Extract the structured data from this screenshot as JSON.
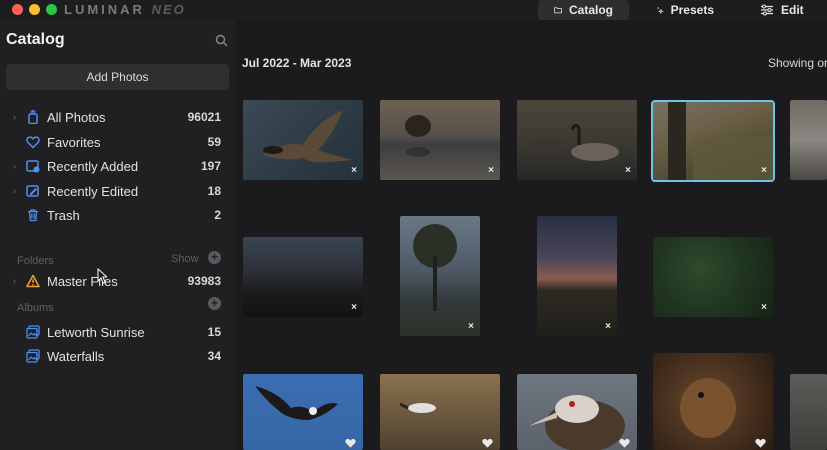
{
  "app": {
    "logo_main": "LUMINAR",
    "logo_neo": "NEO"
  },
  "topnav": {
    "catalog": "Catalog",
    "presets": "Presets",
    "edit": "Edit"
  },
  "sidebar": {
    "title": "Catalog",
    "add_photos": "Add Photos",
    "library": [
      {
        "label": "All Photos",
        "count": "96021",
        "icon": "all-photos-icon",
        "chevron": true
      },
      {
        "label": "Favorites",
        "count": "59",
        "icon": "heart-icon",
        "chevron": false
      },
      {
        "label": "Recently Added",
        "count": "197",
        "icon": "recently-added-icon",
        "chevron": true
      },
      {
        "label": "Recently Edited",
        "count": "18",
        "icon": "recently-edited-icon",
        "chevron": true
      },
      {
        "label": "Trash",
        "count": "2",
        "icon": "trash-icon",
        "chevron": false
      }
    ],
    "folders": {
      "header": "Folders",
      "show": "Show",
      "items": [
        {
          "label": "Master Files",
          "count": "93983",
          "icon": "warning-icon"
        }
      ]
    },
    "albums": {
      "header": "Albums",
      "items": [
        {
          "label": "Letworth Sunrise",
          "count": "15",
          "icon": "album-icon"
        },
        {
          "label": "Waterfalls",
          "count": "34",
          "icon": "album-icon"
        }
      ]
    }
  },
  "main": {
    "date_range": "Jul 2022 - Mar 2023",
    "showing": "Showing or",
    "thumbs": [
      {
        "name": "goose-flying",
        "badge": "×",
        "selected": false
      },
      {
        "name": "beaver-water",
        "badge": "×",
        "selected": false
      },
      {
        "name": "geese-pond",
        "badge": "×",
        "selected": false
      },
      {
        "name": "gorge-tree",
        "badge": "×",
        "selected": true
      },
      {
        "name": "waterfall-edge",
        "badge": "",
        "selected": false
      },
      {
        "name": "dusk-landscape",
        "badge": "×",
        "selected": false
      },
      {
        "name": "tree-valley",
        "badge": "×",
        "selected": false
      },
      {
        "name": "sunset-meadow",
        "badge": "×",
        "selected": false
      },
      {
        "name": "green-foliage",
        "badge": "×",
        "selected": false
      },
      {
        "name": "eagle-flight",
        "badge": "heart",
        "selected": false
      },
      {
        "name": "bird-reeds",
        "badge": "heart",
        "selected": false
      },
      {
        "name": "grebe-closeup",
        "badge": "heart",
        "selected": false
      },
      {
        "name": "beaver-closeup",
        "badge": "heart",
        "selected": false
      }
    ]
  },
  "colors": {
    "accent": "#4d8ef7",
    "selection": "#6fc3e8",
    "warning": "#f0a030"
  }
}
